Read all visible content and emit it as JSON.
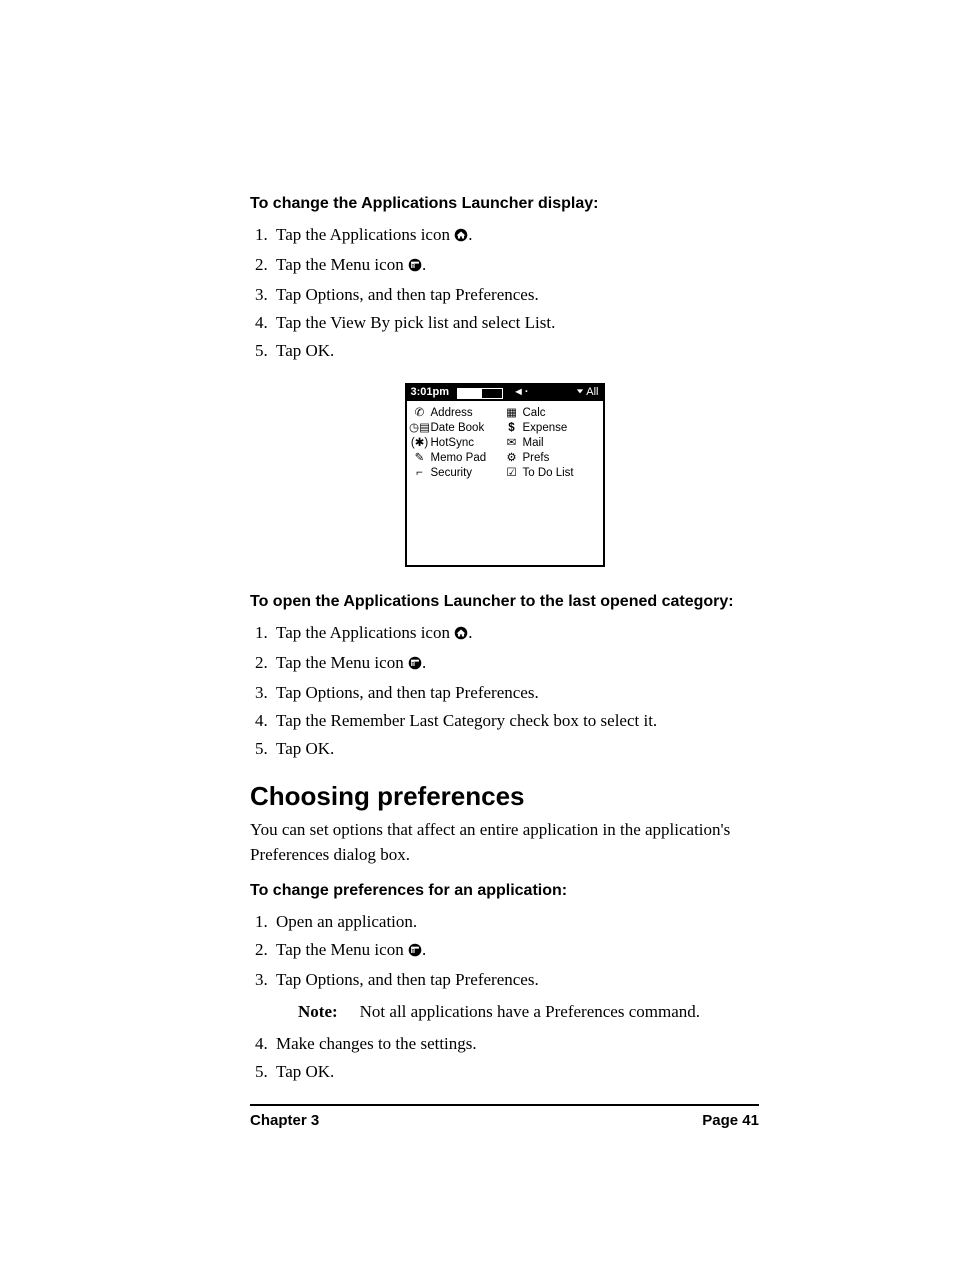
{
  "section1": {
    "heading": "To change the Applications Launcher display:",
    "steps": [
      "Tap the Applications icon ",
      "Tap the Menu icon ",
      "Tap Options, and then tap Preferences.",
      "Tap the View By pick list and select List.",
      "Tap OK."
    ],
    "step1_icon": "applications-icon",
    "step2_icon": "menu-icon"
  },
  "device": {
    "time": "3:01pm",
    "category_label": "All",
    "apps_left": [
      {
        "name": "Address"
      },
      {
        "name": "Date Book"
      },
      {
        "name": "HotSync"
      },
      {
        "name": "Memo Pad"
      },
      {
        "name": "Security"
      }
    ],
    "apps_right": [
      {
        "name": "Calc"
      },
      {
        "name": "Expense"
      },
      {
        "name": "Mail"
      },
      {
        "name": "Prefs"
      },
      {
        "name": "To Do List"
      }
    ]
  },
  "section2": {
    "heading": "To open the Applications Launcher to the last opened category:",
    "steps": [
      "Tap the Applications icon ",
      "Tap the Menu icon ",
      "Tap Options, and then tap Preferences.",
      "Tap the Remember Last Category check box to select it.",
      "Tap OK."
    ],
    "step1_icon": "applications-icon",
    "step2_icon": "menu-icon"
  },
  "section3_title": "Choosing preferences",
  "section3_intro": "You can set options that affect an entire application in the application's Preferences dialog box.",
  "section3": {
    "heading": "To change preferences for an application:",
    "steps": [
      "Open an application.",
      "Tap the Menu icon ",
      "Tap Options, and then tap Preferences.",
      "Make changes to the settings.",
      "Tap OK."
    ],
    "step2_icon": "menu-icon",
    "note_label": "Note:",
    "note_text": "Not all applications have a Preferences command."
  },
  "footer": {
    "left": "Chapter 3",
    "right": "Page 41"
  }
}
